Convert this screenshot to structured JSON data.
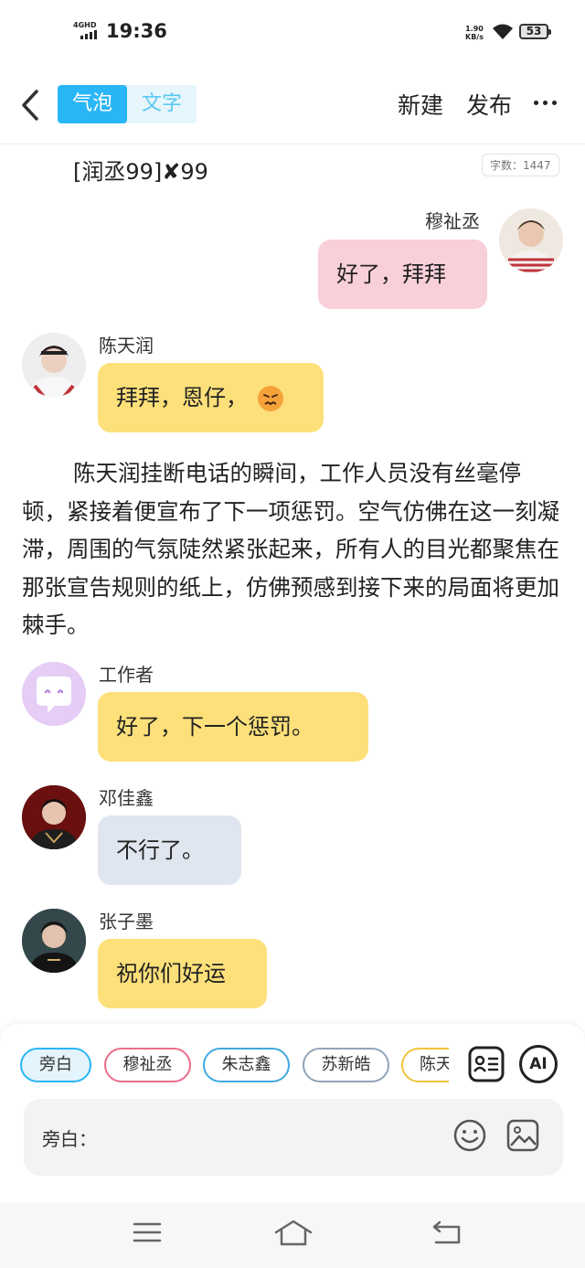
{
  "status_bar": {
    "network": "4GHD",
    "time": "19:36",
    "speed_value": "1.90",
    "speed_unit": "KB/s",
    "battery": "53"
  },
  "header": {
    "tab_bubble": "气泡",
    "tab_text": "文字",
    "new_label": "新建",
    "publish_label": "发布"
  },
  "doc": {
    "title": "[润丞99]✘99",
    "word_count": "字数：1447"
  },
  "messages": [
    {
      "name": "穆祉丞",
      "text": "好了，拜拜"
    },
    {
      "name": "陈天润",
      "text": "拜拜，恩仔，"
    },
    {
      "name": "工作者",
      "text": "好了，下一个惩罚。"
    },
    {
      "name": "邓佳鑫",
      "text": "不行了。"
    },
    {
      "name": "张子墨",
      "text": "祝你们好运"
    }
  ],
  "narration": "陈天润挂断电话的瞬间，工作人员没有丝毫停顿，紧接着便宣布了下一项惩罚。空气仿佛在这一刻凝滞，周围的气氛陡然紧张起来，所有人的目光都聚焦在那张宣告规则的纸上，仿佛预感到接下来的局面将更加棘手。",
  "composer": {
    "chips": [
      "旁白",
      "穆祉丞",
      "朱志鑫",
      "苏新皓",
      "陈天"
    ],
    "ai_label": "AI",
    "input_label": "旁白：",
    "input_value": ""
  },
  "colors": {
    "accent": "#29b6f6",
    "bubble_pink": "#f9cfd9",
    "bubble_yellow": "#fde07a",
    "bubble_gray": "#e0e6ef"
  }
}
